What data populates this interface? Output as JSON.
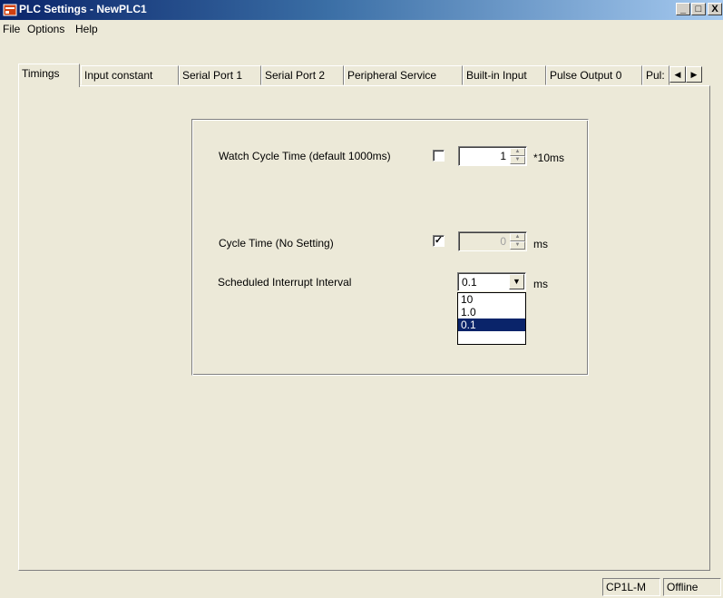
{
  "window": {
    "title": "PLC Settings - NewPLC1",
    "controls": {
      "minimize": "_",
      "maximize": "□",
      "close": "X"
    }
  },
  "menu": {
    "items": [
      "File",
      "Options",
      "Help"
    ]
  },
  "tabs": {
    "items": [
      "Timings",
      "Input constant",
      "Serial Port 1",
      "Serial Port 2",
      "Peripheral Service",
      "Built-in Input",
      "Pulse Output 0",
      "Pul:"
    ],
    "active": "Timings",
    "scroll_left": "◀",
    "scroll_right": "▶"
  },
  "timings": {
    "watch_cycle": {
      "label": "Watch Cycle Time (default 1000ms)",
      "checked": false,
      "value": "1",
      "unit": "*10ms"
    },
    "cycle_time": {
      "label": "Cycle Time (No Setting)",
      "checked": true,
      "check_mark": "✓",
      "value": "0",
      "unit": "ms"
    },
    "interrupt": {
      "label": "Scheduled Interrupt Interval",
      "value": "0.1",
      "unit": "ms",
      "options": [
        "10",
        "1.0",
        "0.1"
      ],
      "selected": "0.1"
    }
  },
  "statusbar": {
    "model": "CP1L-M",
    "status": "Offline"
  },
  "icons": {
    "spin_up": "▲",
    "spin_down": "▼",
    "combo_arrow": "▼"
  },
  "colors": {
    "titlebar_start": "#0a246a",
    "titlebar_end": "#a6caf0",
    "face": "#ece9d8",
    "selection": "#0a246a"
  }
}
